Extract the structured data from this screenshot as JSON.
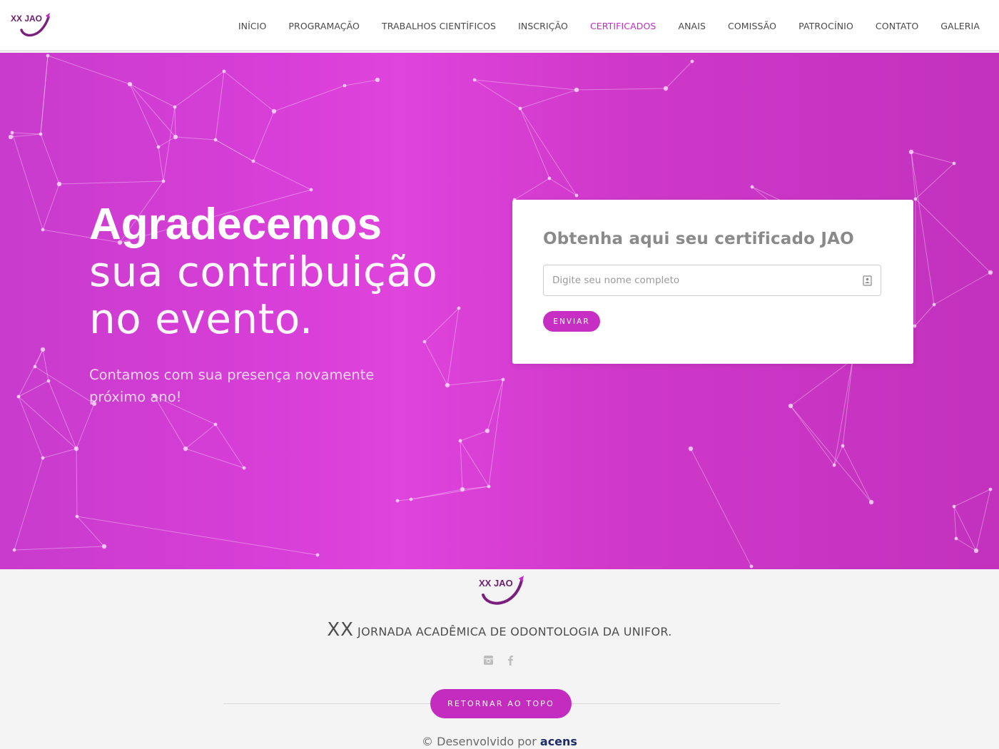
{
  "header": {
    "logo_text": "XX JAO",
    "nav": [
      {
        "label": "INÍCIO",
        "active": false
      },
      {
        "label": "PROGRAMAÇÃO",
        "active": false
      },
      {
        "label": "TRABALHOS CIENTÍFICOS",
        "active": false
      },
      {
        "label": "INSCRIÇÃO",
        "active": false
      },
      {
        "label": "CERTIFICADOS",
        "active": true
      },
      {
        "label": "ANAIS",
        "active": false
      },
      {
        "label": "COMISSÃO",
        "active": false
      },
      {
        "label": "PATROCÍNIO",
        "active": false
      },
      {
        "label": "CONTATO",
        "active": false
      },
      {
        "label": "GALERIA",
        "active": false
      }
    ]
  },
  "hero": {
    "title_bold": "Agradecemos",
    "title_line2": "sua contribuição",
    "title_line3": "no evento.",
    "subtitle": "Contamos com sua presença novamente próximo ano!"
  },
  "form": {
    "title": "Obtenha aqui seu certificado JAO",
    "name_placeholder": "Digite seu nome completo",
    "name_value": "",
    "submit_label": "ENVIAR",
    "input_icon": "contact-card-icon"
  },
  "footer": {
    "logo_text": "XX JAO",
    "title_xx": "XX",
    "title_rest": "JORNADA ACADÊMICA DE ODONTOLOGIA DA UNIFOR.",
    "social": [
      "instagram-icon",
      "facebook-icon"
    ],
    "back_to_top_label": "RETORNAR AO TOPO",
    "credits_prefix": "© Desenvolvido por",
    "credits_brand": "acens"
  },
  "colors": {
    "accent": "#c52ac9",
    "hero_gradient_start": "#c83bcc",
    "hero_gradient_mid": "#df44dc",
    "hero_gradient_end": "#c232bd",
    "button": "#c72ec4",
    "brand_credits": "#1d2d6b"
  }
}
